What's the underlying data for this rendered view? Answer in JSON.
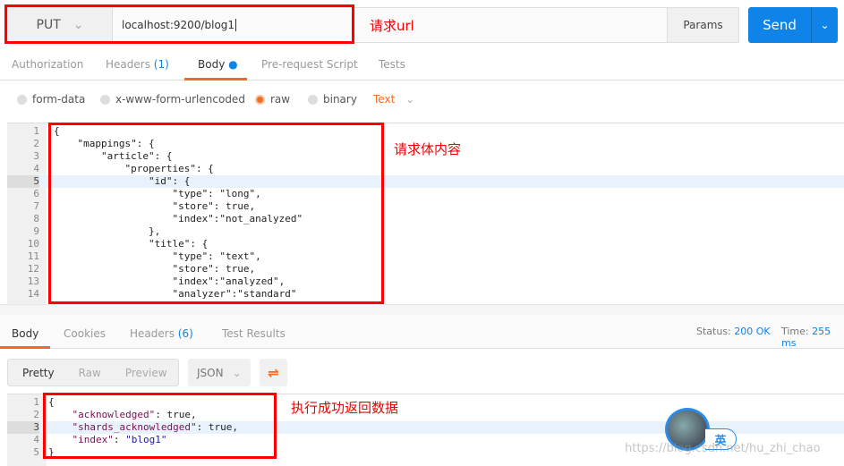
{
  "request": {
    "method": "PUT",
    "url": "localhost:9200/blog1",
    "params_label": "Params",
    "send_label": "Send",
    "annotation_url": "请求url",
    "annotation_body": "请求体内容"
  },
  "req_tabs": {
    "authorization": "Authorization",
    "headers": "Headers",
    "headers_count": "(1)",
    "body": "Body",
    "prerequest": "Pre-request Script",
    "tests": "Tests"
  },
  "body_options": {
    "form_data": "form-data",
    "urlencoded": "x-www-form-urlencoded",
    "raw": "raw",
    "binary": "binary",
    "type": "Text",
    "selected": "raw"
  },
  "request_body_lines": [
    "{",
    "    \"mappings\": {",
    "        \"article\": {",
    "            \"properties\": {",
    "                \"id\": {",
    "                    \"type\": \"long\",",
    "                    \"store\": true,",
    "                    \"index\":\"not_analyzed\"",
    "                },",
    "                \"title\": {",
    "                    \"type\": \"text\",",
    "                    \"store\": true,",
    "                    \"index\":\"analyzed\",",
    "                    \"analyzer\":\"standard\""
  ],
  "line_numbers": [
    "1",
    "2",
    "3",
    "4",
    "5",
    "6",
    "7",
    "8",
    "9",
    "10",
    "11",
    "12",
    "13",
    "14"
  ],
  "response": {
    "tabs": {
      "body": "Body",
      "cookies": "Cookies",
      "headers": "Headers",
      "headers_count": "(6)",
      "test_results": "Test Results"
    },
    "status_label": "Status:",
    "status": "200 OK",
    "time_label": "Time:",
    "time": "255 ms",
    "view": {
      "pretty": "Pretty",
      "raw": "Raw",
      "preview": "Preview",
      "format": "JSON"
    },
    "annotation": "执行成功返回数据",
    "lines": {
      "l1": "{",
      "k2": "\"acknowledged\"",
      "v2": ": true,",
      "k3": "\"shards_acknowledged\"",
      "v3": ": true,",
      "k4": "\"index\"",
      "p4": ": ",
      "v4": "\"blog1\"",
      "l5": "}"
    },
    "line_numbers": [
      "1",
      "2",
      "3",
      "4",
      "5"
    ]
  },
  "overlay": {
    "ime": "英",
    "watermark": "https://blog.csdn.net/hu_zhi_chao"
  }
}
